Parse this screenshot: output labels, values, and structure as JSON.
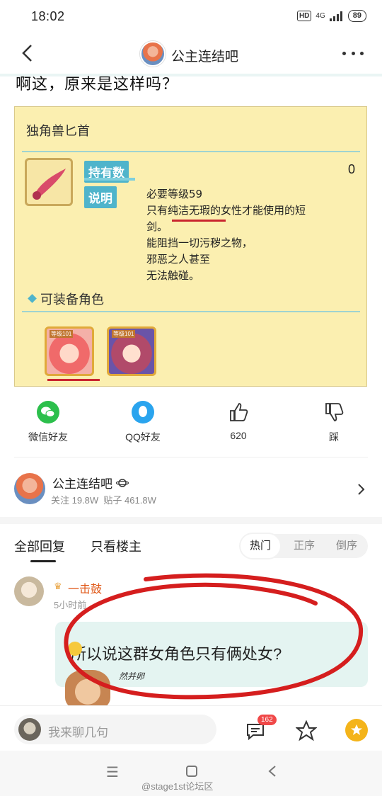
{
  "status": {
    "time": "18:02",
    "hd": "HD",
    "network": "4G",
    "battery": "89"
  },
  "header": {
    "title": "公主连结吧"
  },
  "post": {
    "text": "啊这，原来是这样吗？"
  },
  "card": {
    "item_name": "独角兽匕首",
    "own_label": "持有数",
    "own_value": "0",
    "desc_label": "说明",
    "desc_lines": "必要等级59\n只有纯洁无瑕的女性才能使用的短\n剑。\n能阻挡一切污秽之物，\n邪恶之人甚至\n无法触碰。",
    "equip_label": "可装备角色",
    "char_level1": "等级101",
    "char_level2": "等级101"
  },
  "share": {
    "wechat": "微信好友",
    "qq": "QQ好友",
    "likes": "620",
    "dislike": "踩"
  },
  "forum": {
    "name": "公主连结吧",
    "follow_label": "关注 19.8W",
    "posts_label": "贴子 461.8W"
  },
  "tabs": {
    "all": "全部回复",
    "op_only": "只看楼主",
    "hot": "热门",
    "asc": "正序",
    "desc": "倒序"
  },
  "reply": {
    "username": "一击鼓",
    "time": "5小时前",
    "text": "所以说这群女角色只有俩处女?",
    "sticker_note": "然并卵"
  },
  "bottom": {
    "placeholder": "我来聊几句",
    "comment_count": "162"
  },
  "nav": {
    "watermark": "@stage1st论坛区"
  },
  "colors": {
    "accent_teal": "#4fb4cb",
    "card_bg": "#fbefb0",
    "red_mark": "#c9252f",
    "gold": "#f4b41a"
  }
}
